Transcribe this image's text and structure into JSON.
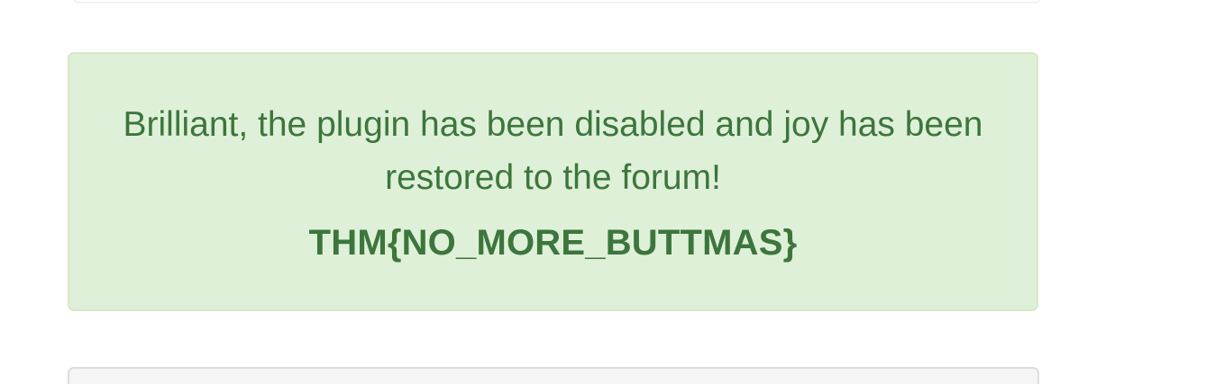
{
  "alert": {
    "message": "Brilliant, the plugin has been disabled and joy has been restored to the forum!",
    "flag": "THM{NO_MORE_BUTTMAS}",
    "colors": {
      "background": "#dff0d8",
      "border": "#d6e9c6",
      "text": "#3c763d"
    }
  },
  "panels": {
    "bottom_background": "#f5f5f5",
    "bottom_border": "#dddddd"
  }
}
